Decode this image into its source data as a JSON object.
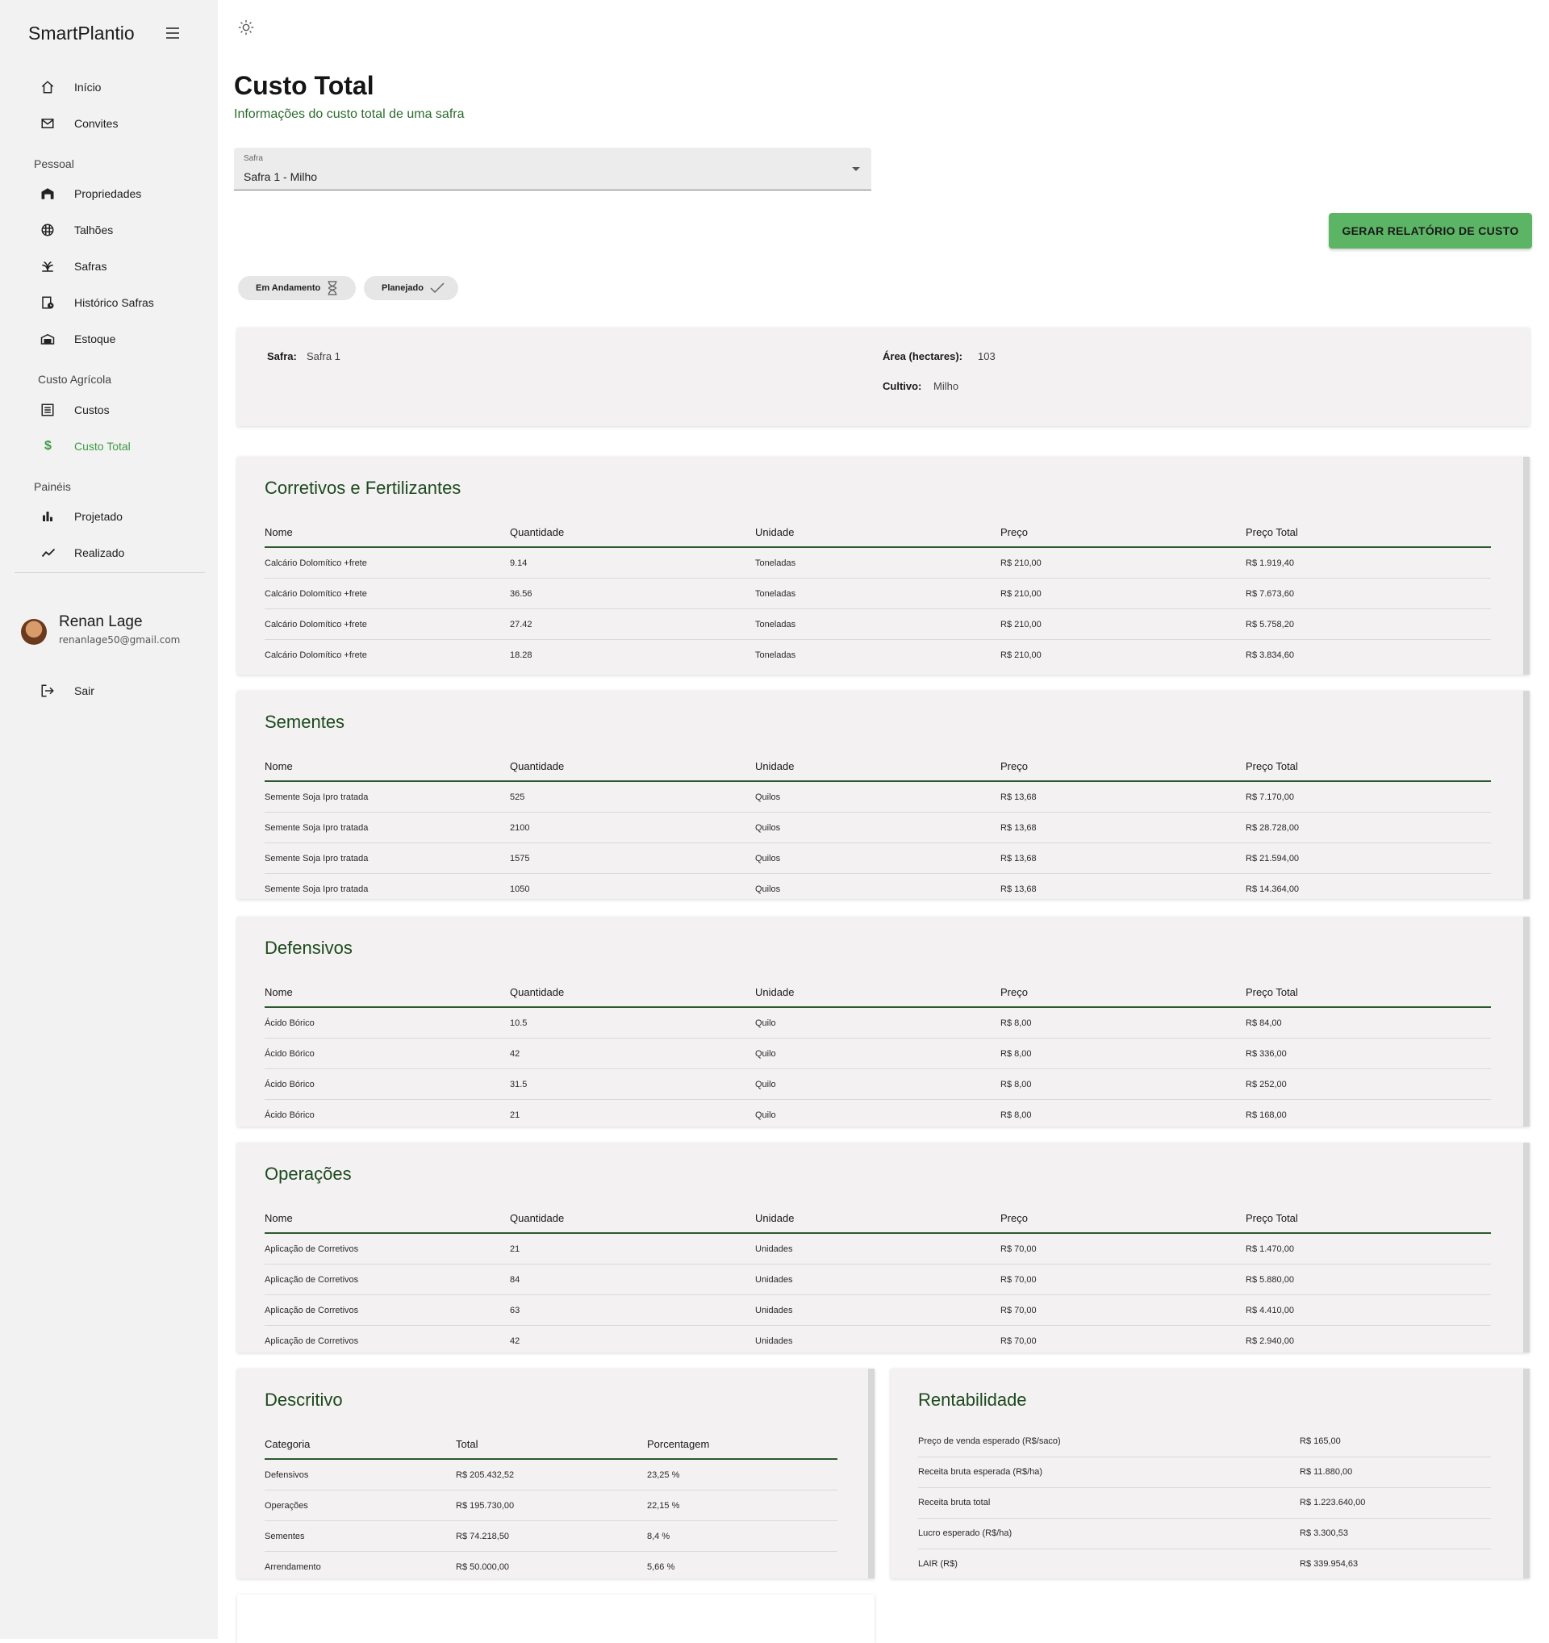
{
  "app": {
    "brand": "SmartPlantio"
  },
  "sidebar": {
    "items_top": [
      {
        "label": "Início",
        "icon": "home-icon"
      },
      {
        "label": "Convites",
        "icon": "mail-icon"
      }
    ],
    "section_pessoal": "Pessoal",
    "items_pessoal": [
      {
        "label": "Propriedades",
        "icon": "warehouse-icon"
      },
      {
        "label": "Talhões",
        "icon": "grid-icon"
      },
      {
        "label": "Safras",
        "icon": "plant-icon"
      },
      {
        "label": "Histórico Safras",
        "icon": "history-icon"
      },
      {
        "label": "Estoque",
        "icon": "storage-icon"
      }
    ],
    "section_custo": "Custo Agrícola",
    "items_custo": [
      {
        "label": "Custos",
        "icon": "list-icon"
      },
      {
        "label": "Custo Total",
        "icon": "dollar-icon"
      }
    ],
    "section_paineis": "Painéis",
    "items_paineis": [
      {
        "label": "Projetado",
        "icon": "bar-chart-icon"
      },
      {
        "label": "Realizado",
        "icon": "trend-icon"
      }
    ],
    "user": {
      "name": "Renan Lage",
      "email": "renanlage50@gmail.com"
    },
    "logout": "Sair",
    "active_color": "#3e9b46"
  },
  "header": {
    "title": "Custo Total",
    "subtitle": "Informações do custo total de uma safra"
  },
  "safra_select": {
    "label": "Safra",
    "value": "Safra 1 - Milho"
  },
  "report_button": "GERAR RELATÓRIO DE CUSTO",
  "chips": [
    {
      "label": "Em Andamento",
      "icon": "hourglass-icon"
    },
    {
      "label": "Planejado",
      "icon": "check-icon"
    }
  ],
  "info": {
    "safra_key": "Safra:",
    "safra_val": "Safra 1",
    "area_key": "Área (hectares):",
    "area_val": "103",
    "cultivo_key": "Cultivo:",
    "cultivo_val": "Milho"
  },
  "columns": [
    "Nome",
    "Quantidade",
    "Unidade",
    "Preço",
    "Preço Total"
  ],
  "tables": [
    {
      "title": "Corretivos e Fertilizantes",
      "rows": [
        [
          "Calcário Dolomítico +frete",
          "9.14",
          "Toneladas",
          "R$ 210,00",
          "R$ 1.919,40"
        ],
        [
          "Calcário Dolomítico +frete",
          "36.56",
          "Toneladas",
          "R$ 210,00",
          "R$ 7.673,60"
        ],
        [
          "Calcário Dolomítico +frete",
          "27.42",
          "Toneladas",
          "R$ 210,00",
          "R$ 5.758,20"
        ],
        [
          "Calcário Dolomítico +frete",
          "18.28",
          "Toneladas",
          "R$ 210,00",
          "R$ 3.834,60"
        ]
      ]
    },
    {
      "title": "Sementes",
      "rows": [
        [
          "Semente Soja Ipro tratada",
          "525",
          "Quilos",
          "R$ 13,68",
          "R$ 7.170,00"
        ],
        [
          "Semente Soja Ipro tratada",
          "2100",
          "Quilos",
          "R$ 13,68",
          "R$ 28.728,00"
        ],
        [
          "Semente Soja Ipro tratada",
          "1575",
          "Quilos",
          "R$ 13,68",
          "R$ 21.594,00"
        ],
        [
          "Semente Soja Ipro tratada",
          "1050",
          "Quilos",
          "R$ 13,68",
          "R$ 14.364,00"
        ]
      ]
    },
    {
      "title": "Defensivos",
      "rows": [
        [
          "Ácido Bórico",
          "10.5",
          "Quilo",
          "R$ 8,00",
          "R$ 84,00"
        ],
        [
          "Ácido Bórico",
          "42",
          "Quilo",
          "R$ 8,00",
          "R$ 336,00"
        ],
        [
          "Ácido Bórico",
          "31.5",
          "Quilo",
          "R$ 8,00",
          "R$ 252,00"
        ],
        [
          "Ácido Bórico",
          "21",
          "Quilo",
          "R$ 8,00",
          "R$ 168,00"
        ]
      ]
    },
    {
      "title": "Operações",
      "rows": [
        [
          "Aplicação de Corretivos",
          "21",
          "Unidades",
          "R$ 70,00",
          "R$ 1.470,00"
        ],
        [
          "Aplicação de Corretivos",
          "84",
          "Unidades",
          "R$ 70,00",
          "R$ 5.880,00"
        ],
        [
          "Aplicação de Corretivos",
          "63",
          "Unidades",
          "R$ 70,00",
          "R$ 4.410,00"
        ],
        [
          "Aplicação de Corretivos",
          "42",
          "Unidades",
          "R$ 70,00",
          "R$ 2.940,00"
        ]
      ]
    }
  ],
  "descritivo": {
    "title": "Descritivo",
    "columns": [
      "Categoria",
      "Total",
      "Porcentagem"
    ],
    "rows": [
      [
        "Defensivos",
        "R$ 205.432,52",
        "23,25 %"
      ],
      [
        "Operações",
        "R$ 195.730,00",
        "22,15 %"
      ],
      [
        "Sementes",
        "R$ 74.218,50",
        "8,4 %"
      ],
      [
        "Arrendamento",
        "R$ 50.000,00",
        "5,66 %"
      ]
    ]
  },
  "rentabilidade": {
    "title": "Rentabilidade",
    "rows": [
      [
        "Preço de venda esperado (R$/saco)",
        "R$ 165,00"
      ],
      [
        "Receita bruta esperada (R$/ha)",
        "R$ 11.880,00"
      ],
      [
        "Receita bruta total",
        "R$ 1.223.640,00"
      ],
      [
        "Lucro esperado (R$/ha)",
        "R$ 3.300,53"
      ],
      [
        "LAIR (R$)",
        "R$ 339.954,63"
      ]
    ]
  }
}
